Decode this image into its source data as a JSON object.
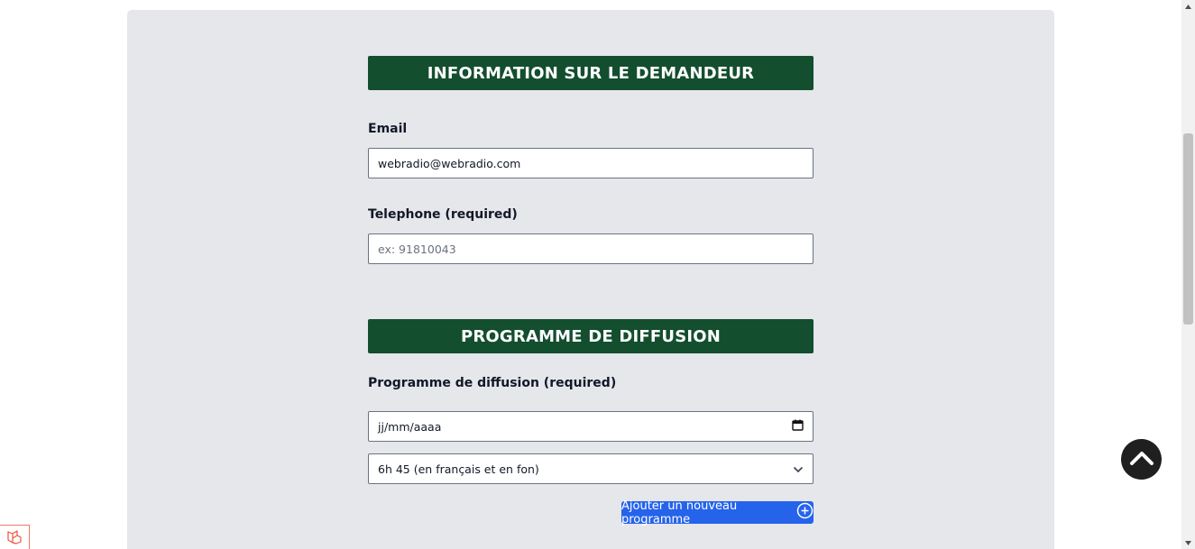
{
  "sections": {
    "applicant_title": "INFORMATION SUR LE DEMANDEUR",
    "program_title": "PROGRAMME DE DIFFUSION"
  },
  "email": {
    "label": "Email",
    "value": "webradio@webradio.com"
  },
  "telephone": {
    "label": "Telephone (required)",
    "value": "",
    "placeholder": "ex: 91810043"
  },
  "program": {
    "label": "Programme de diffusion (required)",
    "date_placeholder": "jj/mm/aaaa",
    "selected_time": "6h 45 (en français et en fon)",
    "add_button_label": "Ajouter un nouveau programme"
  },
  "icons": {
    "calendar": "calendar-icon",
    "chevron": "chevron-down-icon",
    "add": "plus-circle-icon",
    "scroll_top": "chevron-up-icon",
    "laravel": "laravel-logo-icon"
  },
  "colors": {
    "section_header_bg": "#134e2e",
    "panel_bg": "#e5e7eb",
    "button_bg": "#2563eb",
    "scroll_top_bg": "#1f1f1f"
  }
}
